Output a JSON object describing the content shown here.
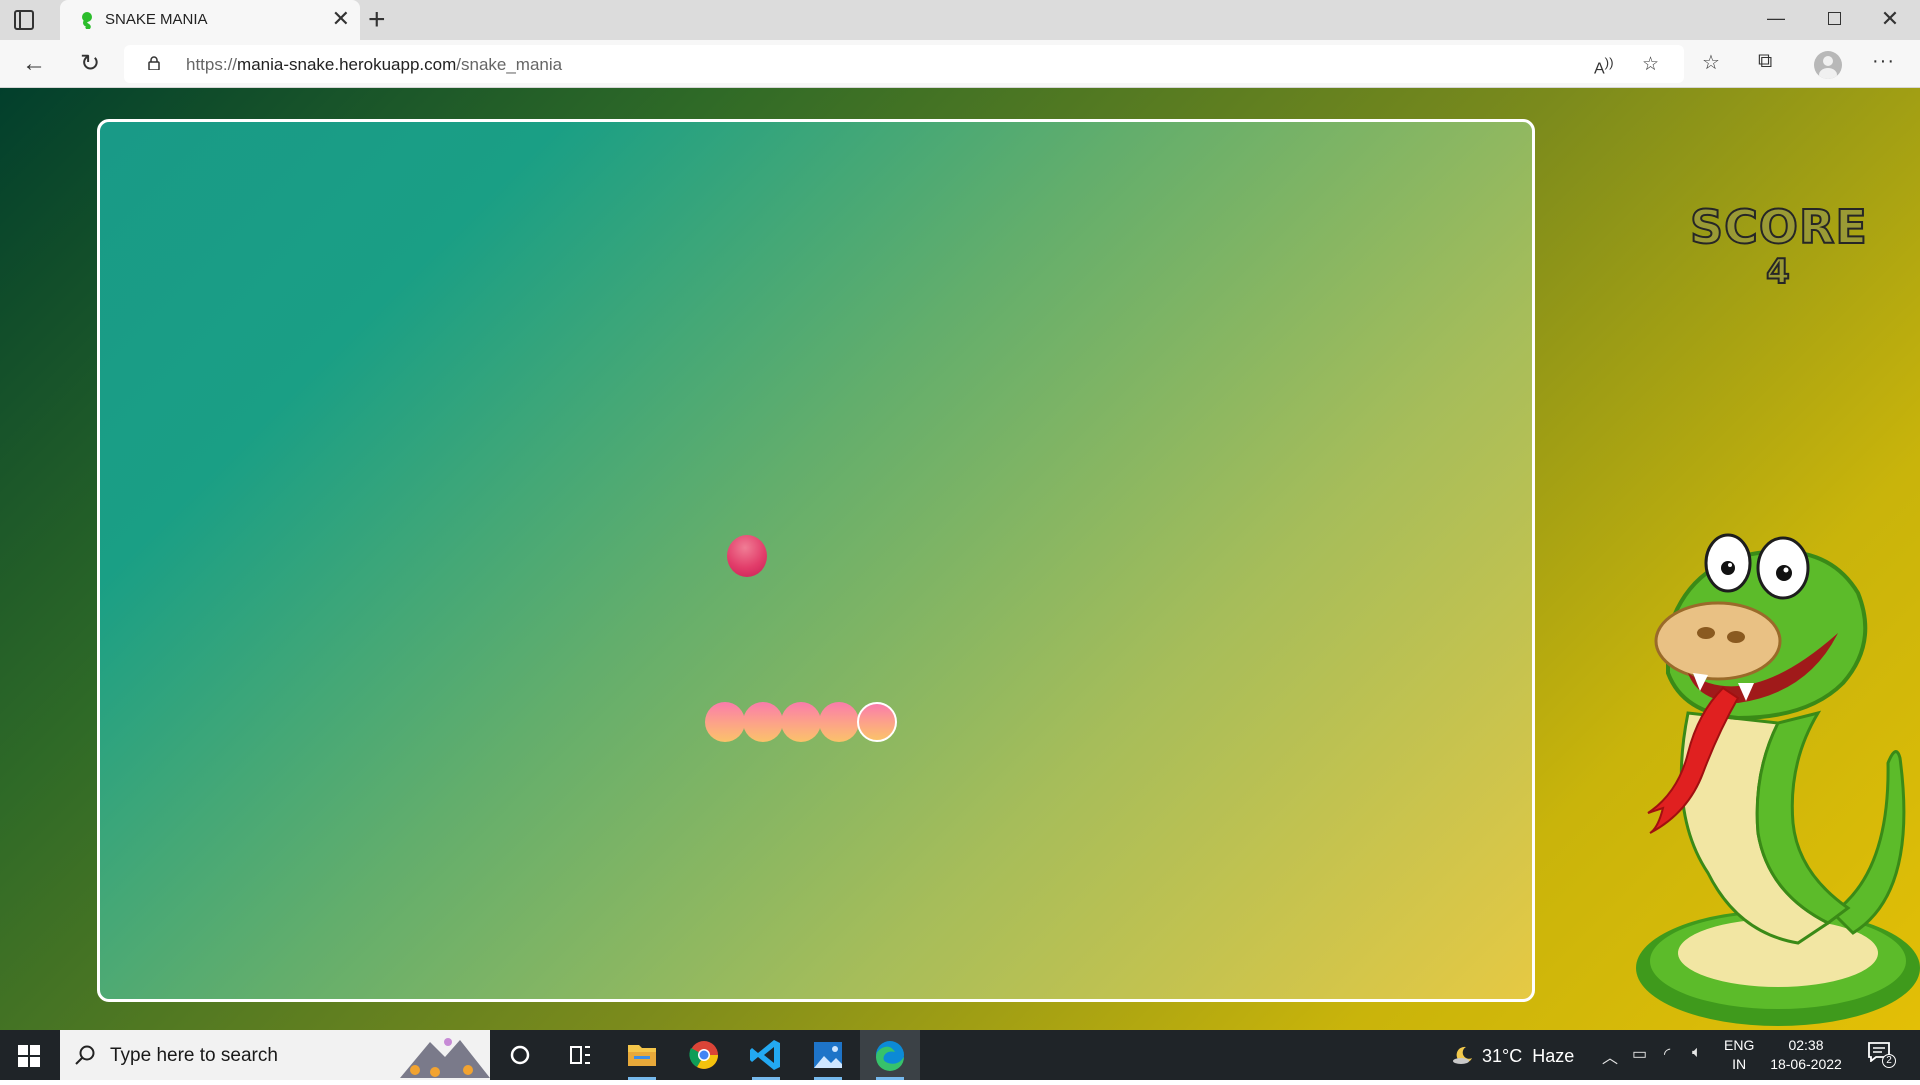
{
  "browser": {
    "tab_title": "SNAKE MANIA",
    "url_host_prefix": "https://",
    "url_host": "mania-snake.herokuapp.com",
    "url_path": "/snake_mania",
    "icons": {
      "tab_actions": "tab-actions-icon",
      "favicon": "snake-favicon-icon",
      "close_tab": "close-icon",
      "new_tab": "plus-icon",
      "back": "back-arrow-icon",
      "reload": "reload-icon",
      "lock": "lock-icon",
      "read_aloud": "read-aloud-icon",
      "add_favorite": "star-add-icon",
      "favorites": "favorites-icon",
      "collections": "collections-icon",
      "profile": "profile-icon",
      "more": "more-icon"
    }
  },
  "game": {
    "score_label": "SCORE",
    "score_value": "4",
    "snake_length": 5,
    "colors": {
      "border": "#ffffff",
      "food": "#e23d6a",
      "snake_top": "#fa7cab",
      "snake_bottom": "#fbc26a",
      "score_text": "#9a9a35"
    }
  },
  "taskbar": {
    "search_placeholder": "Type here to search",
    "weather_temp": "31°C",
    "weather_desc": "Haze",
    "lang_top": "ENG",
    "lang_bottom": "IN",
    "time": "02:38",
    "date": "18-06-2022",
    "notification_count": "2",
    "apps": [
      "cortana-icon",
      "task-view-icon",
      "file-explorer-icon",
      "chrome-icon",
      "vscode-icon",
      "photos-icon",
      "edge-icon"
    ]
  }
}
